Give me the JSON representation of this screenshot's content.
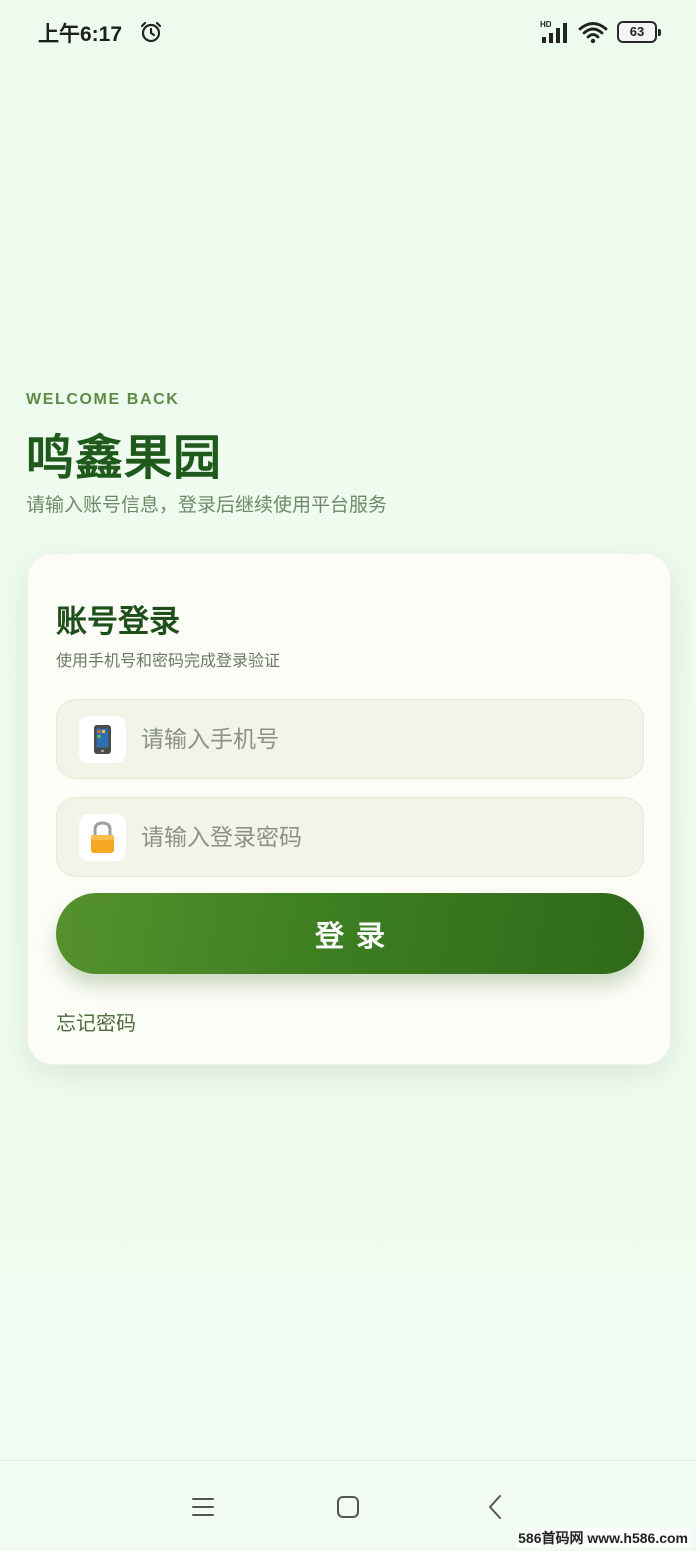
{
  "status_bar": {
    "time": "上午6:17",
    "network_badge": "HD",
    "battery_level": "63",
    "icons": [
      "alarm-icon",
      "signal-icon",
      "wifi-icon",
      "battery-icon"
    ]
  },
  "hero": {
    "welcome": "WELCOME BACK",
    "title": "鸣鑫果园",
    "subtitle": "请输入账号信息，登录后继续使用平台服务"
  },
  "login_card": {
    "title": "账号登录",
    "subtitle": "使用手机号和密码完成登录验证",
    "phone_field": {
      "icon": "mobile-phone-icon",
      "value": "",
      "placeholder": "请输入手机号"
    },
    "password_field": {
      "icon": "lock-icon",
      "value": "",
      "placeholder": "请输入登录密码"
    },
    "login_button_label": "登录",
    "forgot_password_label": "忘记密码"
  },
  "nav_bar": {
    "icons": [
      "menu-icon",
      "home-icon",
      "back-icon"
    ]
  },
  "watermark": "586首码网 www.h586.com",
  "colors": {
    "background": "#eefaee",
    "accent": "#3e7f22",
    "title": "#1f5a1c",
    "card": "#fdfdf8"
  }
}
